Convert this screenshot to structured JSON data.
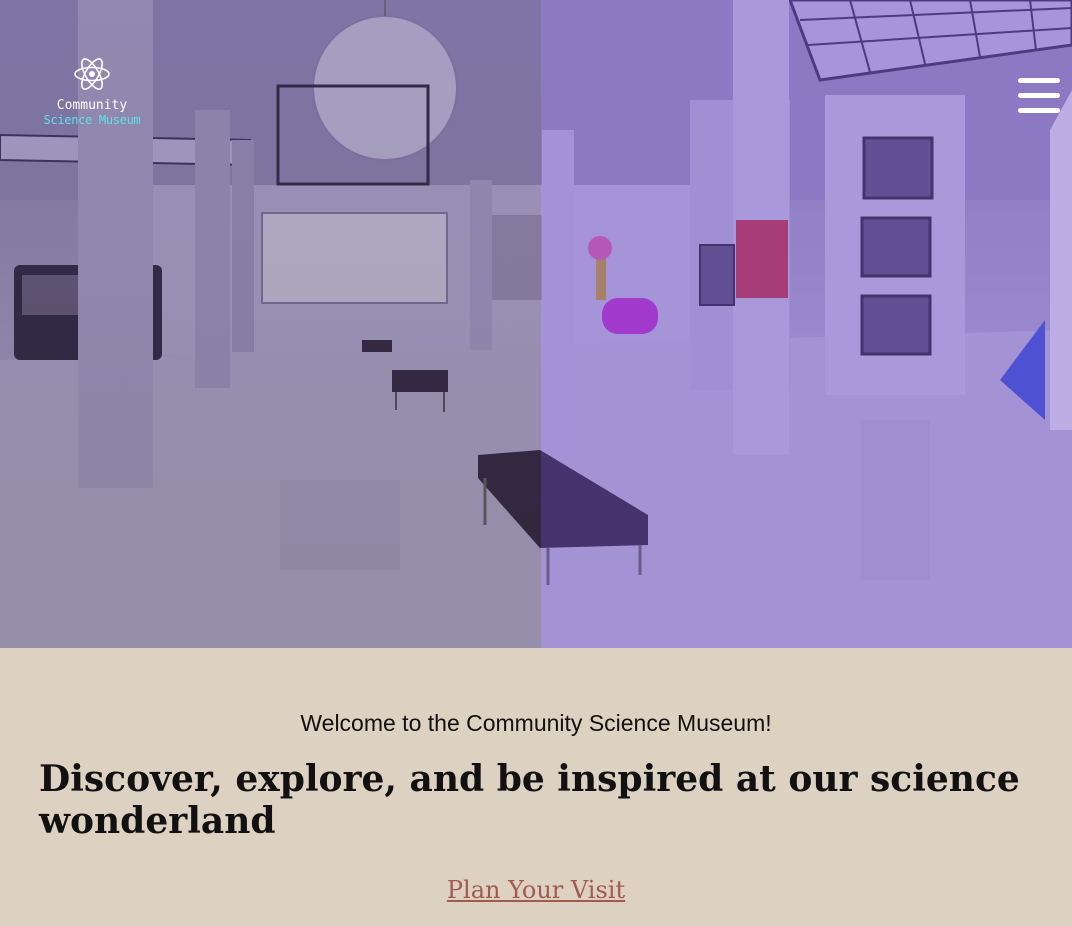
{
  "header": {
    "logo": {
      "line1": "Community",
      "line2": "Science Museum",
      "icon": "atom-icon"
    },
    "menu_icon": "hamburger-menu-icon"
  },
  "hero": {
    "image": "museum-hall-photo"
  },
  "intro": {
    "welcome": "Welcome to the Community Science Museum!",
    "headline": "Discover, explore, and be inspired at our science wonderland",
    "cta_label": "Plan Your Visit"
  },
  "colors": {
    "intro_background": "#ddd1c1",
    "cta_link": "#a35a4d",
    "logo_accent": "#5fe0e8",
    "hero_tint": "#6e4bc8"
  }
}
